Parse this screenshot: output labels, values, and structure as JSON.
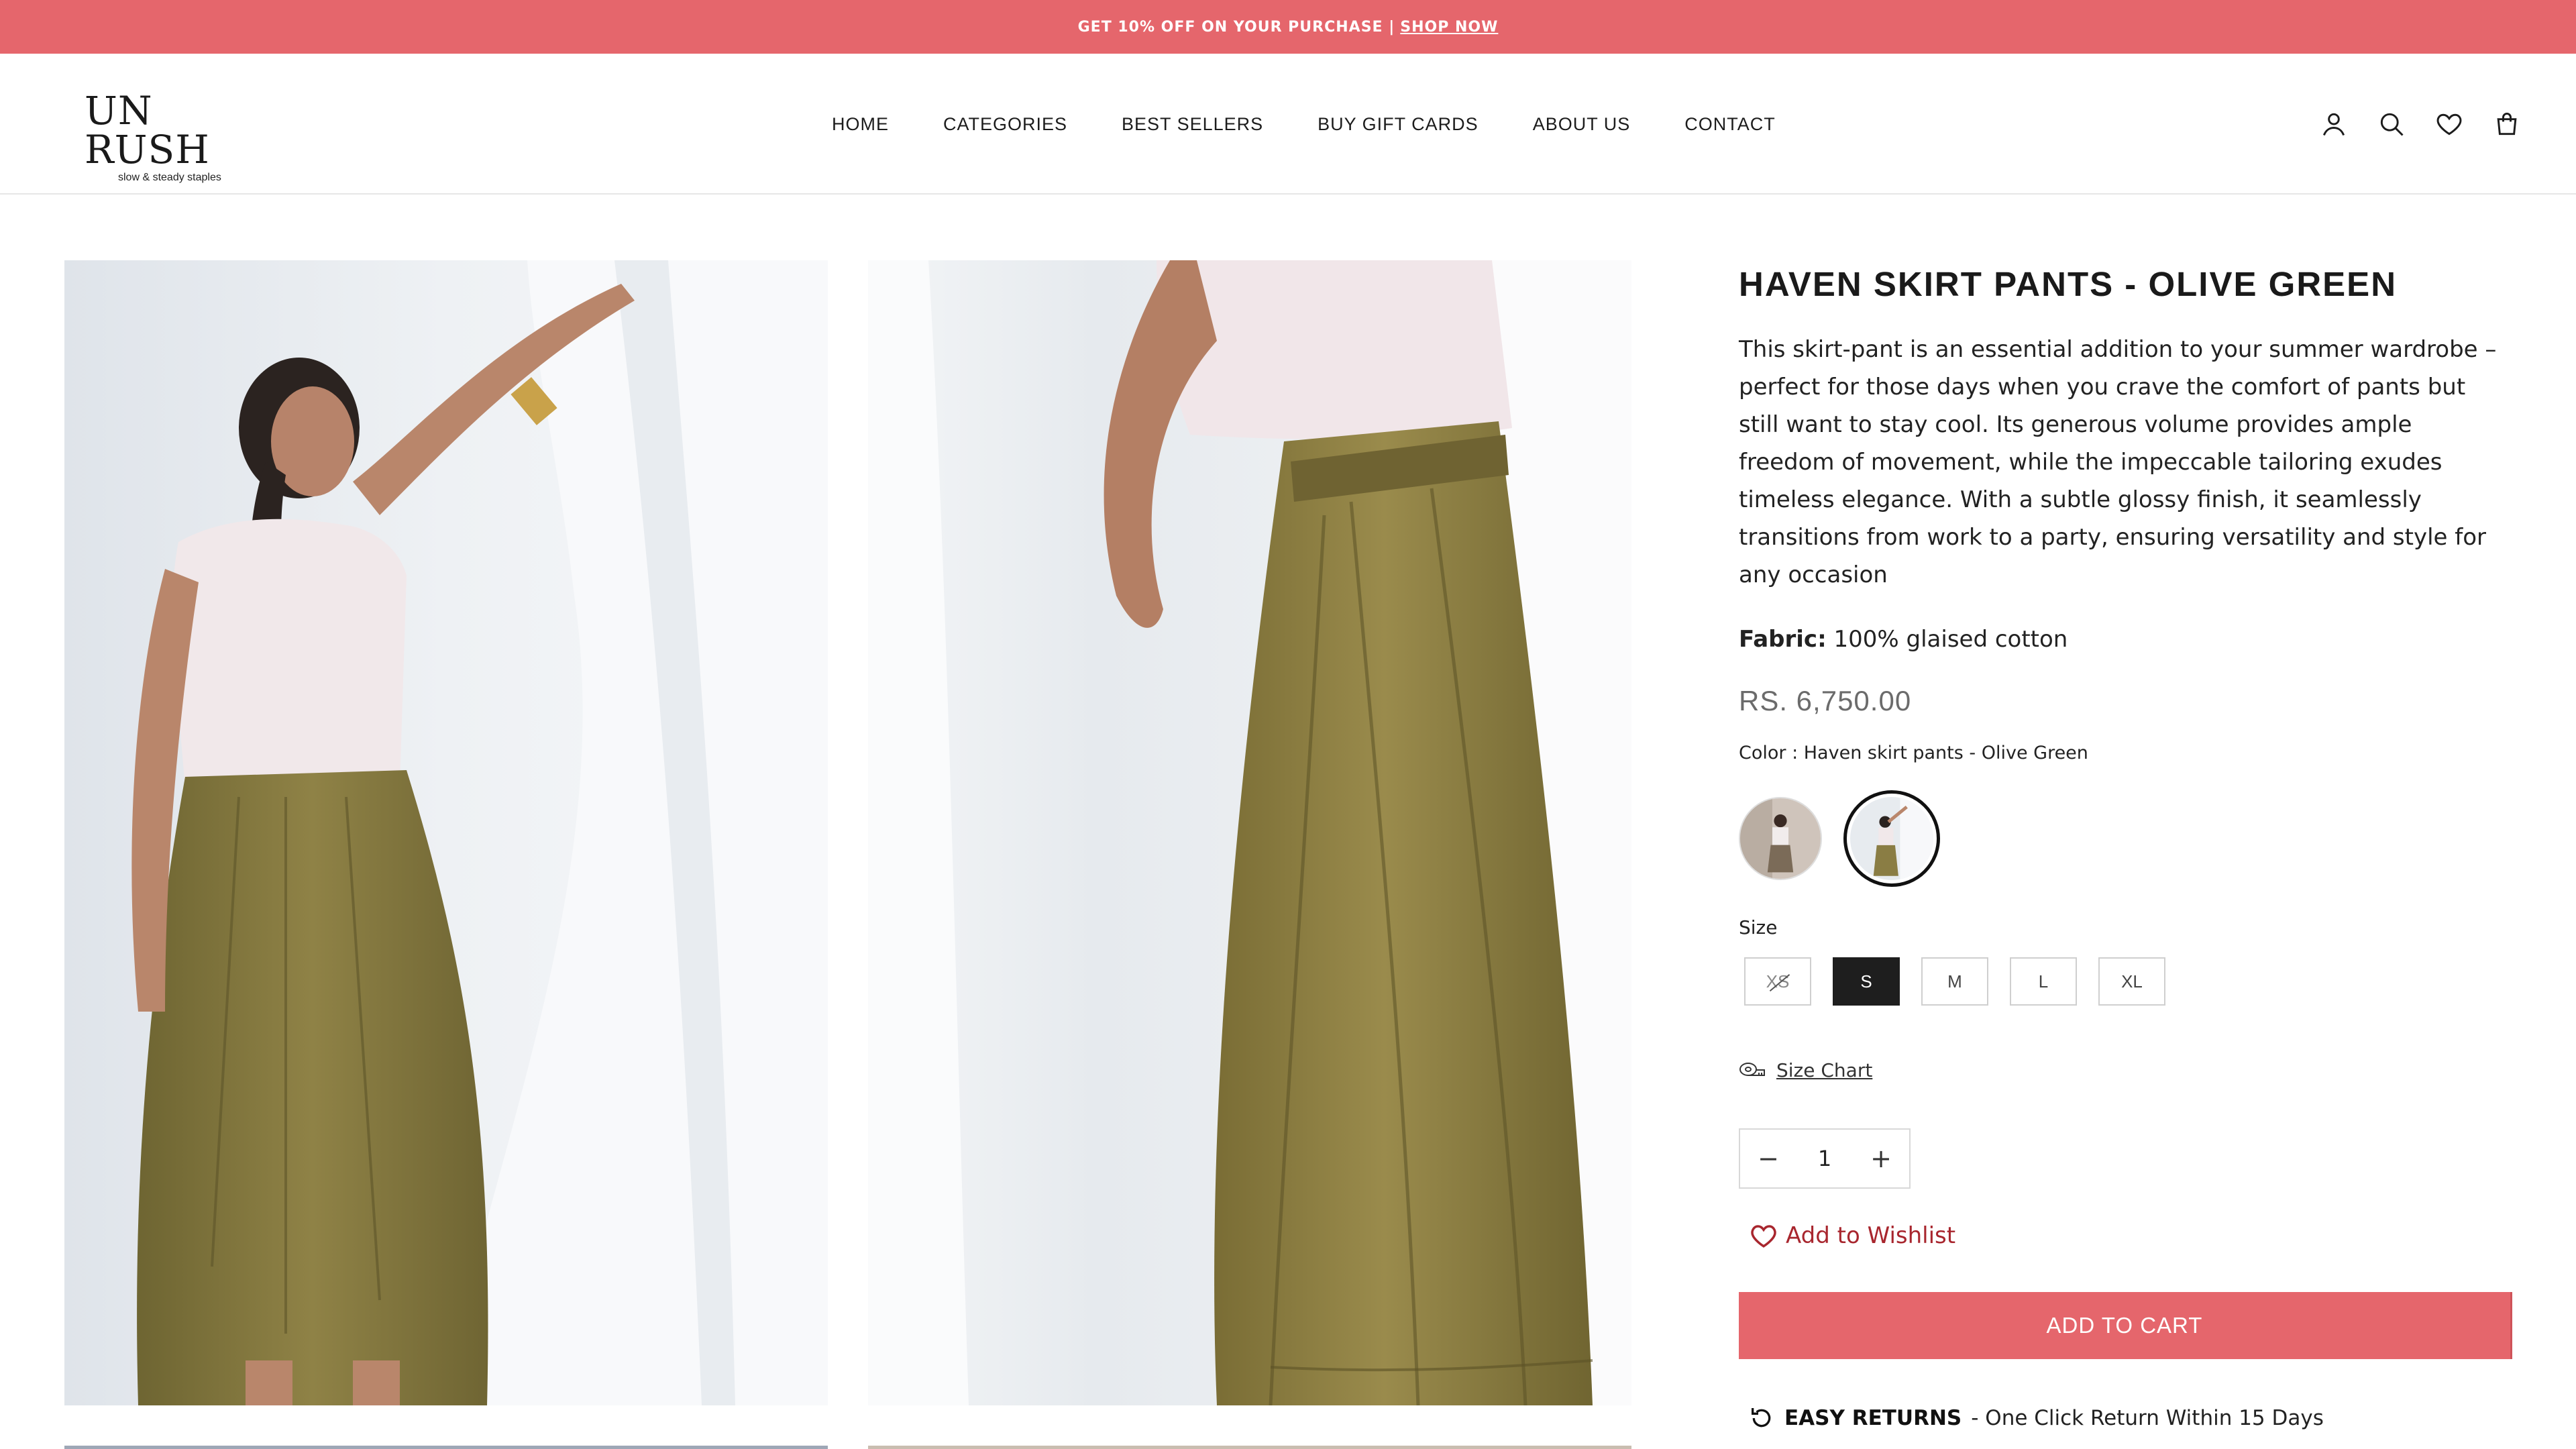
{
  "announcement": {
    "text": "GET 10% OFF ON YOUR PURCHASE |",
    "link": "SHOP NOW"
  },
  "header": {
    "logo": "UN RUSH",
    "tagline": "slow & steady staples",
    "nav": [
      "HOME",
      "CATEGORIES",
      "BEST SELLERS",
      "BUY GIFT CARDS",
      "ABOUT US",
      "CONTACT"
    ],
    "icons": [
      "account-icon",
      "search-icon",
      "wishlist-icon",
      "cart-icon"
    ]
  },
  "product": {
    "title": "HAVEN SKIRT PANTS - OLIVE GREEN",
    "description": "This skirt-pant is an essential addition to your summer wardrobe – perfect for those days when you crave the comfort of pants but still want to stay cool. Its generous volume provides ample freedom of movement, while the impeccable tailoring exudes timeless elegance. With a subtle glossy finish, it seamlessly transitions from work to a party, ensuring versatility and style for any occasion",
    "fabric_label": "Fabric:",
    "fabric_value": "100% glaised cotton",
    "price": "RS. 6,750.00",
    "color_label": "Color : Haven skirt pants - Olive Green",
    "size_label": "Size",
    "sizes": [
      {
        "label": "XS",
        "state": "unavailable"
      },
      {
        "label": "S",
        "state": "selected"
      },
      {
        "label": "M",
        "state": "available"
      },
      {
        "label": "L",
        "state": "available"
      },
      {
        "label": "XL",
        "state": "available"
      }
    ],
    "size_chart": "Size Chart",
    "quantity": "1",
    "qty_minus": "−",
    "qty_plus": "+",
    "wishlist": "Add to Wishlist",
    "add_to_cart": "ADD TO CART",
    "returns_strong": "EASY RETURNS",
    "returns_rest": " - One Click Return Within 15 Days"
  },
  "colors": {
    "accent": "#e5666c",
    "wishlist_text": "#a8262e",
    "olive": "#8b7d42"
  }
}
